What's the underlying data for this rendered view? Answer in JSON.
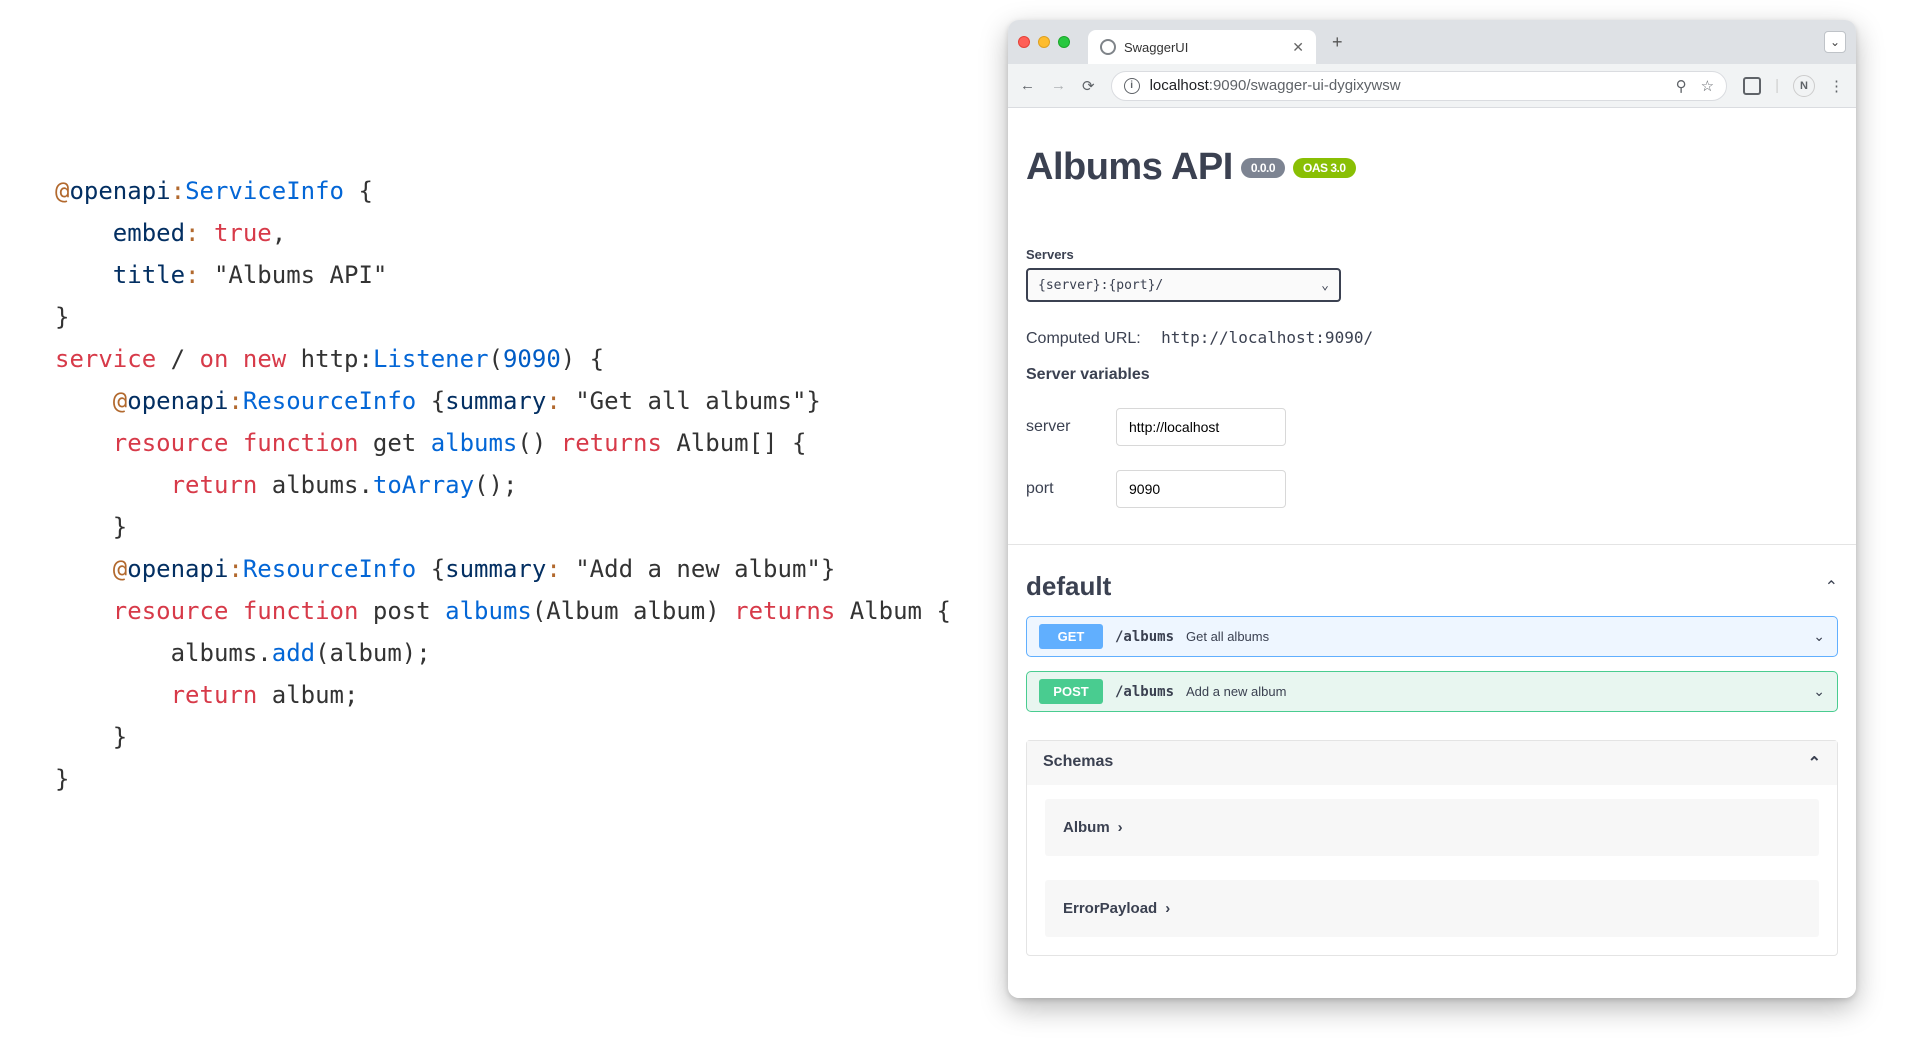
{
  "code": {
    "lines": [
      [
        {
          "t": "brown",
          "v": "@"
        },
        {
          "t": "attrkey",
          "v": "openapi"
        },
        {
          "t": "brown",
          "v": ":"
        },
        {
          "t": "type",
          "v": "ServiceInfo"
        },
        {
          "t": "",
          "v": " {"
        }
      ],
      [
        {
          "t": "",
          "v": "    "
        },
        {
          "t": "attrkey",
          "v": "embed"
        },
        {
          "t": "brown",
          "v": ":"
        },
        {
          "t": "",
          "v": " "
        },
        {
          "t": "key",
          "v": "true"
        },
        {
          "t": "",
          "v": ","
        }
      ],
      [
        {
          "t": "",
          "v": "    "
        },
        {
          "t": "attrkey",
          "v": "title"
        },
        {
          "t": "brown",
          "v": ":"
        },
        {
          "t": "",
          "v": " "
        },
        {
          "t": "str",
          "v": "\"Albums API\""
        }
      ],
      [
        {
          "t": "",
          "v": "}"
        }
      ],
      [
        {
          "t": "svc",
          "v": "service"
        },
        {
          "t": "",
          "v": " / "
        },
        {
          "t": "svc",
          "v": "on"
        },
        {
          "t": "",
          "v": " "
        },
        {
          "t": "new",
          "v": "new"
        },
        {
          "t": "",
          "v": " http:"
        },
        {
          "t": "type",
          "v": "Listener"
        },
        {
          "t": "",
          "v": "("
        },
        {
          "t": "num",
          "v": "9090"
        },
        {
          "t": "",
          "v": ") {"
        }
      ],
      [
        {
          "t": "",
          "v": ""
        }
      ],
      [
        {
          "t": "",
          "v": "    "
        },
        {
          "t": "brown",
          "v": "@"
        },
        {
          "t": "attrkey",
          "v": "openapi"
        },
        {
          "t": "brown",
          "v": ":"
        },
        {
          "t": "type",
          "v": "ResourceInfo"
        },
        {
          "t": "",
          "v": " {"
        },
        {
          "t": "attrkey",
          "v": "summary"
        },
        {
          "t": "brown",
          "v": ":"
        },
        {
          "t": "",
          "v": " "
        },
        {
          "t": "str",
          "v": "\"Get all albums\""
        },
        {
          "t": "",
          "v": "}"
        }
      ],
      [
        {
          "t": "",
          "v": "    "
        },
        {
          "t": "svc",
          "v": "resource"
        },
        {
          "t": "",
          "v": " "
        },
        {
          "t": "svc",
          "v": "function"
        },
        {
          "t": "",
          "v": " get "
        },
        {
          "t": "func",
          "v": "albums"
        },
        {
          "t": "",
          "v": "() "
        },
        {
          "t": "svc",
          "v": "returns"
        },
        {
          "t": "",
          "v": " Album[] {"
        }
      ],
      [
        {
          "t": "",
          "v": "        "
        },
        {
          "t": "svc",
          "v": "return"
        },
        {
          "t": "",
          "v": " albums."
        },
        {
          "t": "func",
          "v": "toArray"
        },
        {
          "t": "",
          "v": "();"
        }
      ],
      [
        {
          "t": "",
          "v": "    }"
        }
      ],
      [
        {
          "t": "",
          "v": ""
        }
      ],
      [
        {
          "t": "",
          "v": "    "
        },
        {
          "t": "brown",
          "v": "@"
        },
        {
          "t": "attrkey",
          "v": "openapi"
        },
        {
          "t": "brown",
          "v": ":"
        },
        {
          "t": "type",
          "v": "ResourceInfo"
        },
        {
          "t": "",
          "v": " {"
        },
        {
          "t": "attrkey",
          "v": "summary"
        },
        {
          "t": "brown",
          "v": ":"
        },
        {
          "t": "",
          "v": " "
        },
        {
          "t": "str",
          "v": "\"Add a new album\""
        },
        {
          "t": "",
          "v": "}"
        }
      ],
      [
        {
          "t": "",
          "v": "    "
        },
        {
          "t": "svc",
          "v": "resource"
        },
        {
          "t": "",
          "v": " "
        },
        {
          "t": "svc",
          "v": "function"
        },
        {
          "t": "",
          "v": " post "
        },
        {
          "t": "func",
          "v": "albums"
        },
        {
          "t": "",
          "v": "(Album album) "
        },
        {
          "t": "svc",
          "v": "returns"
        },
        {
          "t": "",
          "v": " Album {"
        }
      ],
      [
        {
          "t": "",
          "v": "        albums."
        },
        {
          "t": "func",
          "v": "add"
        },
        {
          "t": "",
          "v": "(album);"
        }
      ],
      [
        {
          "t": "",
          "v": "        "
        },
        {
          "t": "svc",
          "v": "return"
        },
        {
          "t": "",
          "v": " album;"
        }
      ],
      [
        {
          "t": "",
          "v": "    }"
        }
      ],
      [
        {
          "t": "",
          "v": "}"
        }
      ]
    ]
  },
  "browser": {
    "tab_title": "SwaggerUI",
    "url_host": "localhost",
    "url_port": ":9090",
    "url_path": "/swagger-ui-dygixywsw"
  },
  "swagger": {
    "title": "Albums API",
    "version_badge": "0.0.0",
    "oas_badge": "OAS 3.0",
    "servers_label": "Servers",
    "servers_select": "{server}:{port}/",
    "computed_label": "Computed URL:",
    "computed_url": "http://localhost:9090/",
    "vars_label": "Server variables",
    "vars": [
      {
        "name": "server",
        "value": "http://localhost"
      },
      {
        "name": "port",
        "value": "9090"
      }
    ],
    "tag": "default",
    "ops": [
      {
        "method": "GET",
        "cls": "get",
        "path": "/albums",
        "summary": "Get all albums"
      },
      {
        "method": "POST",
        "cls": "post",
        "path": "/albums",
        "summary": "Add a new album"
      }
    ],
    "schemas_label": "Schemas",
    "schemas": [
      "Album",
      "ErrorPayload"
    ]
  }
}
